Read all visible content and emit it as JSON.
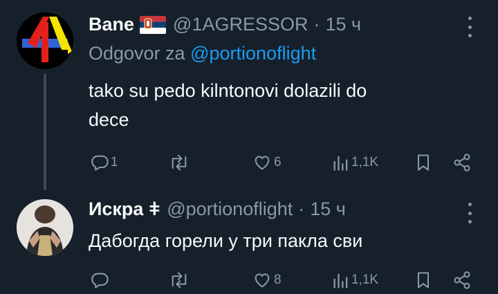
{
  "tweets": [
    {
      "name": "Bane",
      "flag": "serbia-flag",
      "handle": "@1AGRESSOR",
      "separator": "·",
      "time": "15 ч",
      "reply_prefix": "Odgovor za",
      "reply_mention": "@portionoflight",
      "text_line1": "tako su pedo kilntonovi dolazili do",
      "text_line2": "dece",
      "replies": "1",
      "reposts": "",
      "likes": "6",
      "views": "1,1K"
    },
    {
      "name": "Искра",
      "name_symbol": "ǂ",
      "handle": "@portionoflight",
      "separator": "·",
      "time": "15 ч",
      "text_line1": "Дабогда горели у три пакла сви",
      "replies": "",
      "reposts": "",
      "likes": "8",
      "views": "1,1K"
    }
  ],
  "colors": {
    "background": "#15202b",
    "text_primary": "#f7f9f9",
    "text_secondary": "#8b98a5",
    "link": "#1d9bf0",
    "thread_line": "#3d4953"
  }
}
